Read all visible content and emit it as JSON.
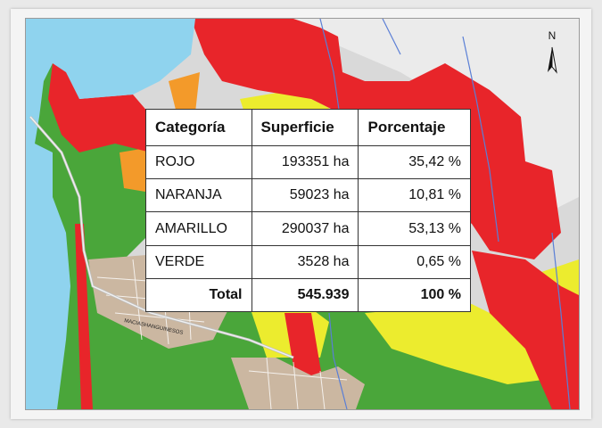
{
  "north_label": "N",
  "road_label": "MACIASHANGUINESOS",
  "colors": {
    "rojo": "#e8252a",
    "naranja": "#f39a2a",
    "amarillo": "#ecec2e",
    "verde": "#4aa63a",
    "water": "#8fd3ee",
    "relief": "#d8d8d8",
    "urban": "#cbb7a1"
  },
  "table": {
    "headers": [
      "Categoría",
      "Superficie",
      "Porcentaje"
    ],
    "rows": [
      {
        "category": "ROJO",
        "surface": "193351 ha",
        "percent": "35,42 %"
      },
      {
        "category": "NARANJA",
        "surface": "59023 ha",
        "percent": "10,81 %"
      },
      {
        "category": "AMARILLO",
        "surface": "290037 ha",
        "percent": "53,13 %"
      },
      {
        "category": "VERDE",
        "surface": "3528 ha",
        "percent": "0,65 %"
      }
    ],
    "total": {
      "label": "Total",
      "surface": "545.939",
      "percent": "100 %"
    }
  }
}
